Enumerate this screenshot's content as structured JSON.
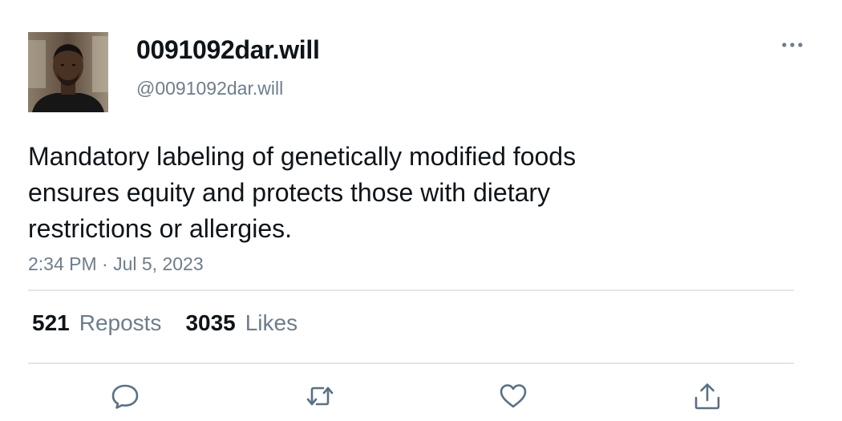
{
  "tweet": {
    "display_name": "0091092dar.will",
    "handle": "@0091092dar.will",
    "text_lines": [
      "Mandatory labeling of genetically modified foods",
      "ensures equity and protects those with dietary",
      "restrictions or allergies."
    ],
    "timestamp": "2:34 PM · Jul 5, 2023"
  },
  "stats": {
    "reposts_count": "521",
    "reposts_label": "Reposts",
    "likes_count": "3035",
    "likes_label": "Likes"
  },
  "icons": {
    "more": "more-horizontal-icon",
    "reply": "reply-icon",
    "repost": "repost-icon",
    "like": "heart-icon",
    "share": "share-icon"
  },
  "colors": {
    "text_primary": "#0f1419",
    "text_secondary": "#6e7d8b",
    "divider": "#e3e6e9",
    "icon": "#5b7083"
  }
}
